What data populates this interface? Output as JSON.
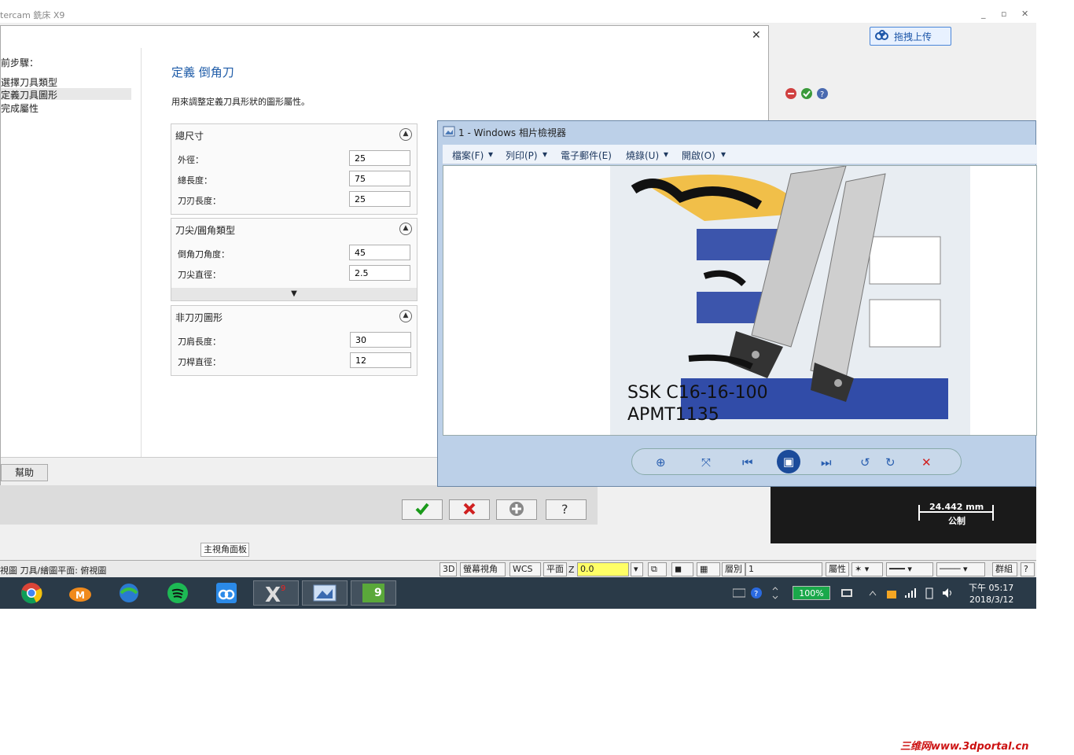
{
  "app": {
    "title": "tercam 銑床 X9",
    "min": "_",
    "max": "▫",
    "close": "✕",
    "upload_label": "拖拽上传"
  },
  "dialog": {
    "close": "✕",
    "steps_head": "前步驟：",
    "steps": [
      "選擇刀具類型",
      "定義刀具圖形",
      "完成屬性"
    ],
    "title": "定義 倒角刀",
    "description": "用來調整定義刀具形狀的圖形屬性。",
    "groups": [
      {
        "title": "總尺寸",
        "fields": [
          {
            "label": "外徑：",
            "value": "25"
          },
          {
            "label": "總長度：",
            "value": "75"
          },
          {
            "label": "刀刃長度：",
            "value": "25"
          }
        ]
      },
      {
        "title": "刀尖/圓角類型",
        "fields": [
          {
            "label": "倒角刀角度：",
            "value": "45"
          },
          {
            "label": "刀尖直徑：",
            "value": "2.5"
          }
        ]
      },
      {
        "title": "非刀刃圖形",
        "fields": [
          {
            "label": "刀肩長度：",
            "value": "30"
          },
          {
            "label": "刀桿直徑：",
            "value": "12"
          }
        ]
      }
    ],
    "help": "幫助"
  },
  "viewer": {
    "title": "1 - Windows 相片檢視器",
    "menu": [
      "檔案(F)",
      "列印(P)",
      "電子郵件(E)",
      "燒錄(U)",
      "開啟(O)"
    ],
    "photo_text": [
      "SSK C16-16-100",
      "APMT1135"
    ]
  },
  "scale": {
    "value": "24.442 mm",
    "unit": "公制"
  },
  "tabs": {
    "main_panel": "主視角面板"
  },
  "status": {
    "text": "視圖 刀具/繪圖平面: 俯視圖",
    "btn_3d": "3D",
    "btn_screen_view": "螢幕視角",
    "btn_wcs": "WCS",
    "btn_plane": "平面",
    "z_label": "Z",
    "z_value": "0.0",
    "layer_label": "層別",
    "layer_value": "1",
    "attr_label": "屬性",
    "group_label": "群組",
    "help_q": "?"
  },
  "taskbar": {
    "battery": "100%",
    "time": "下午 05:17",
    "date": "2018/3/12"
  },
  "watermark": "三维网www.3dportal.cn",
  "colors": {
    "accent": "#1f5ca8",
    "taskbar": "#2a3a48",
    "battery": "#1aa84a"
  }
}
